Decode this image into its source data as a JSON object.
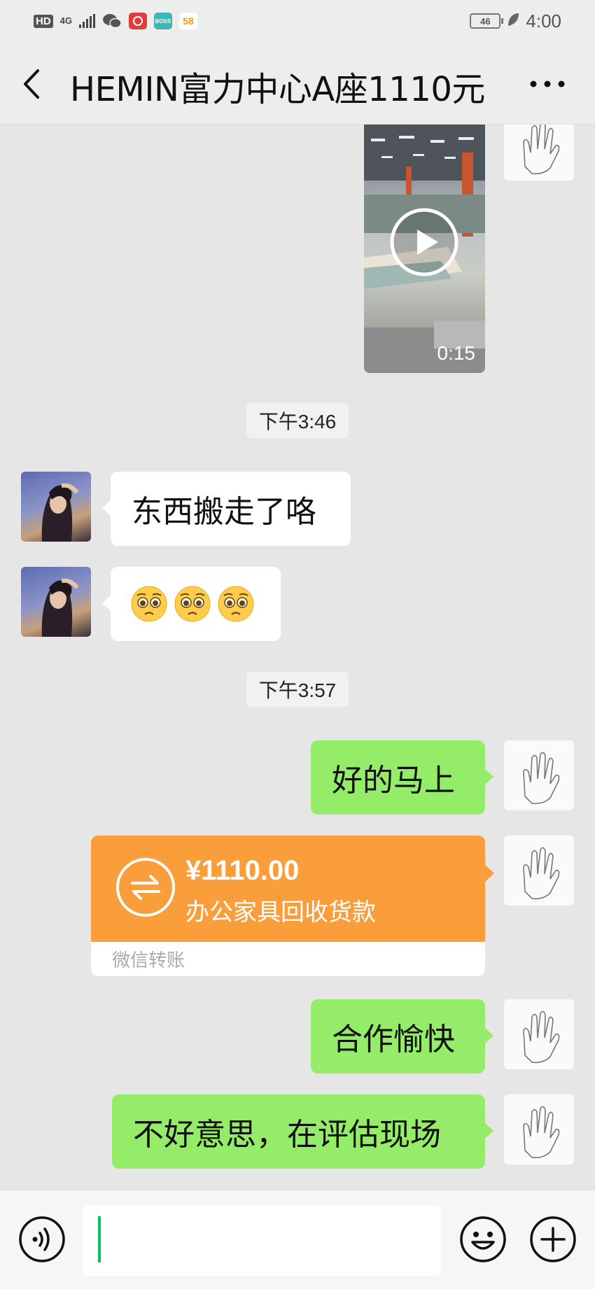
{
  "status_bar": {
    "hd": "HD",
    "network": "4G",
    "app_icons": [
      "wechat-icon",
      "app-icon-red",
      "boss-icon",
      "58-icon"
    ],
    "boss_label": "BOSS",
    "app_58_label": "58",
    "battery": "46",
    "time": "4:00"
  },
  "header": {
    "title": "HEMIN富力中心A座1110元"
  },
  "chat": {
    "video": {
      "duration": "0:15"
    },
    "timestamps": [
      "下午3:46",
      "下午3:57"
    ],
    "messages": [
      {
        "sender": "other",
        "text": "东西搬走了咯"
      },
      {
        "sender": "other",
        "emojis": [
          "pleading-face-emoji",
          "pleading-face-emoji",
          "pleading-face-emoji"
        ]
      },
      {
        "sender": "self",
        "text": "好的马上"
      },
      {
        "sender": "self",
        "text": "合作愉快"
      },
      {
        "sender": "self",
        "text": "不好意思，在评估现场"
      }
    ],
    "transfer": {
      "amount": "¥1110.00",
      "description": "办公家具回收货款",
      "footer": "微信转账"
    }
  },
  "colors": {
    "background": "#ededed",
    "outgoing_bubble": "#95ec69",
    "incoming_bubble": "#ffffff",
    "transfer": "#fa9d3b",
    "caret": "#07c160"
  },
  "input": {
    "value": "",
    "placeholder": ""
  }
}
